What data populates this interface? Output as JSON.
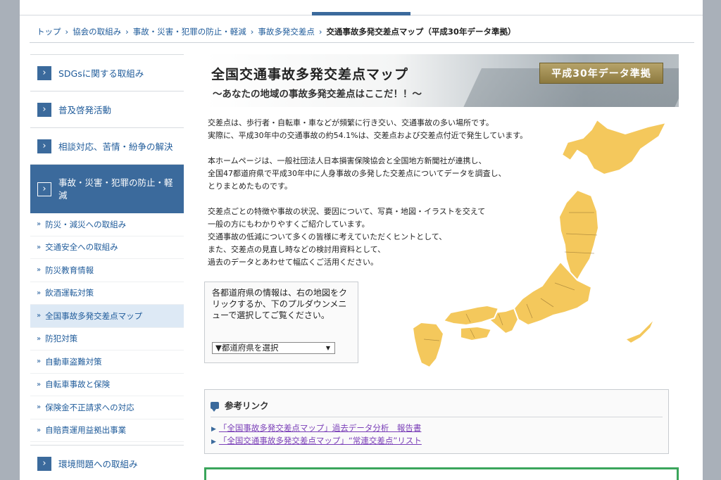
{
  "topnav": {
    "tabs": [
      "",
      "",
      "",
      "",
      ""
    ],
    "active_index": 2
  },
  "breadcrumb": {
    "items": [
      "トップ",
      "協会の取組み",
      "事故・災害・犯罪の防止・軽減",
      "事故多発交差点"
    ],
    "separator": "›",
    "current": "交通事故多発交差点マップ（平成30年データ準拠）"
  },
  "sidebar": {
    "main_items": [
      {
        "label": "SDGsに関する取組み"
      },
      {
        "label": "普及啓発活動"
      },
      {
        "label": "相談対応、苦情・紛争の解決"
      },
      {
        "label": "事故・災害・犯罪の防止・軽減"
      }
    ],
    "chevron": "›",
    "sub_arrow": "»",
    "sub_items": [
      {
        "label": "防災・減災への取組み"
      },
      {
        "label": "交通安全への取組み"
      },
      {
        "label": "防災教育情報"
      },
      {
        "label": "飲酒運転対策"
      },
      {
        "label": "全国事故多発交差点マップ"
      },
      {
        "label": "防犯対策"
      },
      {
        "label": "自動車盗難対策"
      },
      {
        "label": "自転車事故と保険"
      },
      {
        "label": "保険金不正請求への対応"
      },
      {
        "label": "自賠責運用益拠出事業"
      }
    ],
    "current_sub_index": 4,
    "last_item": {
      "label": "環境問題への取組み"
    }
  },
  "hero": {
    "title": "全国交通事故多発交差点マップ",
    "subtitle": "〜あなたの地域の事故多発交差点はここだ！！〜",
    "badge": "平成30年データ準拠"
  },
  "intro": {
    "p1_l1": "交差点は、歩行者・自転車・車などが頻繁に行き交い、交通事故の多い場所です。",
    "p1_l2": "実際に、平成30年中の交通事故の約54.1%は、交差点および交差点付近で発生しています。",
    "p2_l1": "本ホームページは、一般社団法人日本損害保険協会と全国地方新聞社が連携し、",
    "p2_l2": "全国47都道府県で平成30年中に人身事故の多発した交差点についてデータを調査し、",
    "p2_l3": "とりまとめたものです。",
    "p3_l1": "交差点ごとの特徴や事故の状況、要因について、写真・地図・イラストを交えて",
    "p3_l2": "一般の方にもわかりやすくご紹介しています。",
    "p3_l3": "交通事故の低減について多くの皆様に考えていただくヒントとして、",
    "p3_l4": "また、交差点の見直し時などの検討用資料として、",
    "p3_l5": "過去のデータとあわせて幅広くご活用ください。"
  },
  "selector": {
    "text": "各都道府県の情報は、右の地図をクリックするか、下のプルダウンメニューで選択してご覧ください。",
    "dropdown_value": "▼都道府県を選択",
    "caret": "▼"
  },
  "references": {
    "heading": "参考リンク",
    "bullet": "▶",
    "links": [
      "「全国事故多発交差点マップ」過去データ分析　報告書",
      "「全国交通事故多発交差点マップ」“常連交差点”リスト"
    ]
  },
  "colors": {
    "brand": "#3b6a9c",
    "map_fill": "#f4c85c",
    "visited_link": "#7a3fb8",
    "bottom_box_border": "#3aa55b"
  }
}
